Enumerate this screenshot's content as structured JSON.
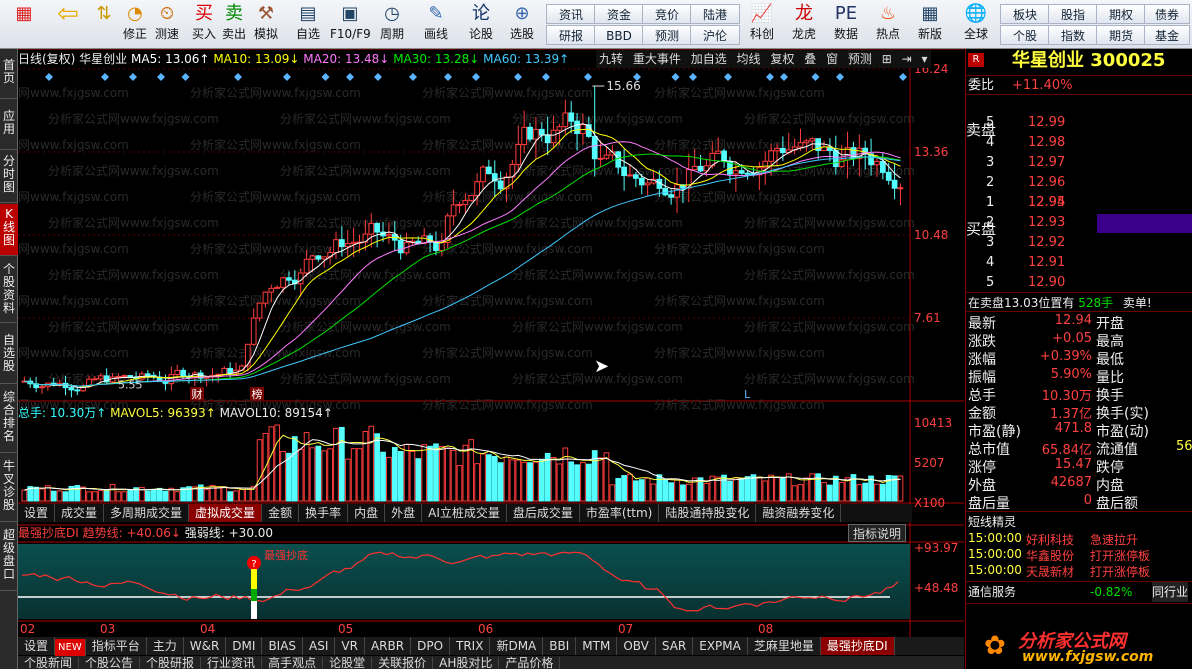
{
  "toolbar": {
    "buttons": [
      "修正",
      "测速",
      "买入",
      "卖出",
      "模拟",
      "自选",
      "F10/F9",
      "周期",
      "画线",
      "论股",
      "选股",
      "科创",
      "龙虎",
      "数据",
      "热点",
      "新版",
      "全球"
    ],
    "small": [
      [
        "资讯",
        "资金",
        "竞价",
        "陆港"
      ],
      [
        "研报",
        "BBD",
        "预测",
        "沪伦"
      ],
      [
        "板块",
        "股指",
        "期权",
        "债券"
      ],
      [
        "个股",
        "指数",
        "期货",
        "基金"
      ]
    ]
  },
  "left_tabs": [
    "首页",
    "应用",
    "分时图",
    "K线图",
    "个股资料",
    "自选股",
    "综合排名",
    "牛叉诊股",
    "超级盘口"
  ],
  "chart": {
    "header": "日线(复权) 华星创业",
    "ma": [
      "MA5: 13.06↑",
      "MA10: 13.09↓",
      "MA20: 13.48↓",
      "MA30: 13.28↓",
      "MA60: 13.39↑"
    ],
    "tools": [
      "九转",
      "重大事件",
      "加自选",
      "均线",
      "复权",
      "叠",
      "窗",
      "预测"
    ],
    "y_labels": [
      "16.24",
      "13.36",
      "10.48",
      "7.61"
    ],
    "peak": "15.66",
    "low": "5.55",
    "markers": [
      "财",
      "榜",
      "L"
    ],
    "vol_header": [
      "总手: 10.30万↑",
      "MAVOL5: 96393↑",
      "MAVOL10: 89154↑"
    ],
    "vol_labels": [
      "10413",
      "5207",
      "X100"
    ],
    "vol_tabs": [
      "设置",
      "成交量",
      "多周期成交量",
      "虚拟成交量",
      "金额",
      "换手率",
      "内盘",
      "外盘",
      "AI立桩成交量",
      "盘后成交量",
      "市盈率(ttm)",
      "陆股通持股变化",
      "融资融券变化"
    ],
    "ind_header": [
      "最强抄底DI",
      "趋势线: +40.06↓",
      "强弱线: +30.00"
    ],
    "ind_btn": "指标说明",
    "ind_labels": [
      "+93.97",
      "+48.48"
    ],
    "ind_marker": "最强抄底",
    "x_labels": [
      "02",
      "03",
      "04",
      "05",
      "06",
      "07",
      "08"
    ],
    "watermark": "分析家公式网www.fxjgsw.com"
  },
  "bottom_tabs": [
    "设置",
    "NEW",
    "指标平台",
    "主力",
    "W&R",
    "DMI",
    "BIAS",
    "ASI",
    "VR",
    "ARBR",
    "DPO",
    "TRIX",
    "新DMA",
    "BBI",
    "MTM",
    "OBV",
    "SAR",
    "EXPMA",
    "芝麻里地量",
    "最强抄底DI"
  ],
  "bottom_tabs2": [
    "个股新闻",
    "个股公告",
    "个股研报",
    "行业资讯",
    "高手观点",
    "论股堂",
    "关联报价",
    "AH股对比",
    "产品价格"
  ],
  "quote": {
    "title": "华星创业 300025",
    "wb_label": "委比",
    "wb": "+11.40%",
    "sell_side": "卖盘",
    "buy_side": "买盘",
    "asks": [
      [
        "5",
        "12.99"
      ],
      [
        "4",
        "12.98"
      ],
      [
        "3",
        "12.97"
      ],
      [
        "2",
        "12.96"
      ],
      [
        "1",
        "12.95"
      ]
    ],
    "bids": [
      [
        "1",
        "12.94"
      ],
      [
        "2",
        "12.93"
      ],
      [
        "3",
        "12.92"
      ],
      [
        "4",
        "12.91"
      ],
      [
        "5",
        "12.90"
      ]
    ],
    "status": [
      "在卖盘13.03位置有",
      "528手",
      "卖单!"
    ],
    "stats": [
      [
        "最新",
        "12.94",
        "开盘",
        ""
      ],
      [
        "涨跌",
        "+0.05",
        "最高",
        ""
      ],
      [
        "涨幅",
        "+0.39%",
        "最低",
        ""
      ],
      [
        "振幅",
        "5.90%",
        "量比",
        ""
      ],
      [
        "总手",
        "10.30万",
        "换手",
        ""
      ],
      [
        "金额",
        "1.37亿",
        "换手(实)",
        ""
      ],
      [
        "市盈(静)",
        "471.8",
        "市盈(动)",
        ""
      ],
      [
        "总市值",
        "65.84亿",
        "流通值",
        "56"
      ],
      [
        "涨停",
        "15.47",
        "跌停",
        ""
      ],
      [
        "外盘",
        "42687",
        "内盘",
        ""
      ],
      [
        "盘后量",
        "0",
        "盘后额",
        ""
      ]
    ],
    "short_title": "短线精灵",
    "short": [
      [
        "15:00:00",
        "好利科技",
        "急速拉升"
      ],
      [
        "15:00:00",
        "华鑫股份",
        "打开涨停板"
      ],
      [
        "15:00:00",
        "天晟新材",
        "打开涨停板"
      ]
    ],
    "tongxin": "通信服务",
    "tongxin_pct": "-0.82%",
    "tongxin_rt": "同行业",
    "brand": "分析家公式网",
    "brand_url": "www.fxjgsw.com"
  },
  "colors": {
    "up": "#ff3c3c",
    "down": "#54ffff",
    "ma5": "#ffffff",
    "ma10": "#ffff00",
    "ma20": "#ff7cff",
    "ma30": "#00e000",
    "ma60": "#40c8ff"
  }
}
